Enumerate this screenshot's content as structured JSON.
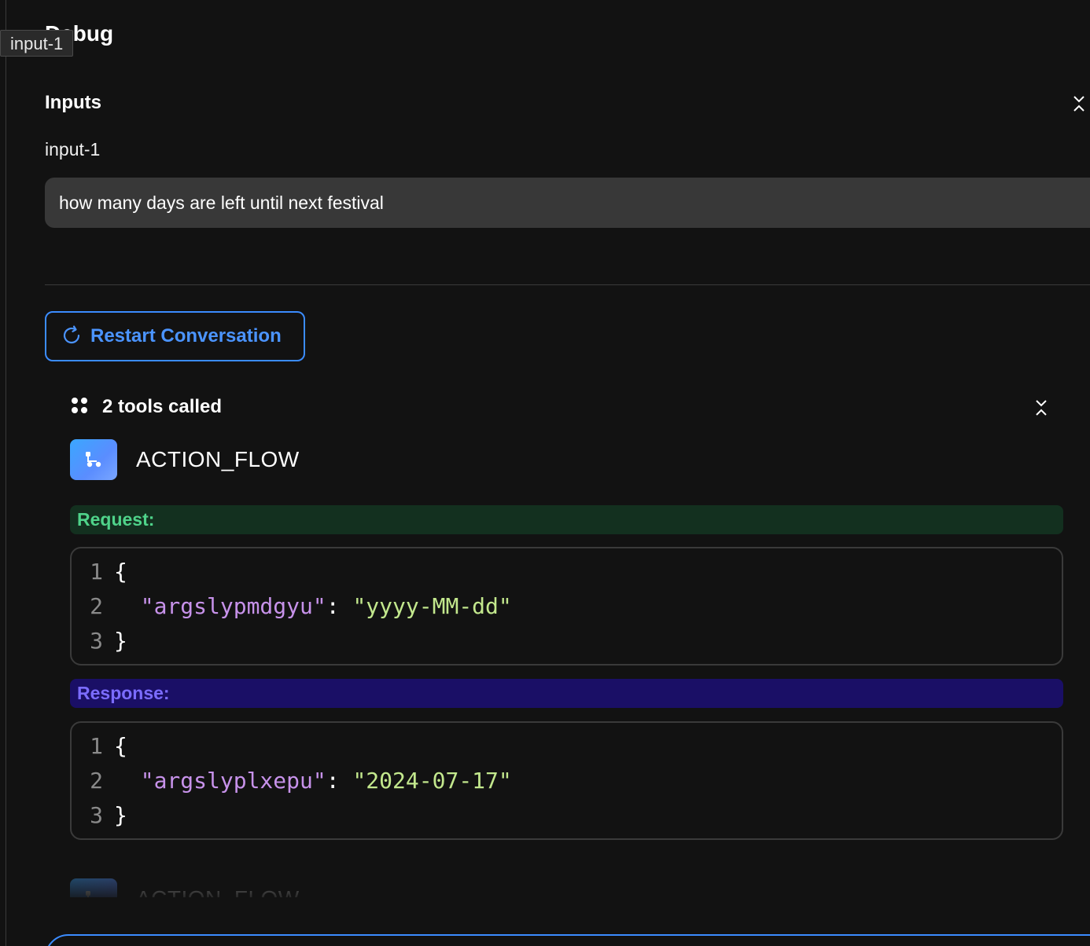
{
  "panel": {
    "title": "Debug",
    "tooltip": "input-1"
  },
  "inputs": {
    "section_title": "Inputs",
    "field_label": "input-1",
    "field_value": "how many days are left until next festival"
  },
  "actions": {
    "restart_label": "Restart Conversation"
  },
  "tools": {
    "summary_label": "2 tools called",
    "items": [
      {
        "name": "ACTION_FLOW",
        "request_label": "Request:",
        "request_lines": [
          {
            "n": "1",
            "text": "{"
          },
          {
            "n": "2",
            "key": "\"argslypmdgyu\"",
            "value": "\"yyyy-MM-dd\""
          },
          {
            "n": "3",
            "text": "}"
          }
        ],
        "response_label": "Response:",
        "response_lines": [
          {
            "n": "1",
            "text": "{"
          },
          {
            "n": "2",
            "key": "\"argslyplxepu\"",
            "value": "\"2024-07-17\""
          },
          {
            "n": "3",
            "text": "}"
          }
        ]
      },
      {
        "name": "ACTION_FLOW"
      }
    ]
  },
  "colors": {
    "accent": "#3b8cff",
    "request_bg": "#13301f",
    "request_text": "#4fd38a",
    "response_bg": "#1a0f66",
    "response_text": "#7b6cff",
    "code_key": "#c792ea",
    "code_string": "#c3e88d"
  },
  "icons": {
    "collapse": "chevrons-collapse-icon",
    "restart": "refresh-icon",
    "tools": "four-dots-icon",
    "tool_badge": "flow-branch-icon"
  }
}
